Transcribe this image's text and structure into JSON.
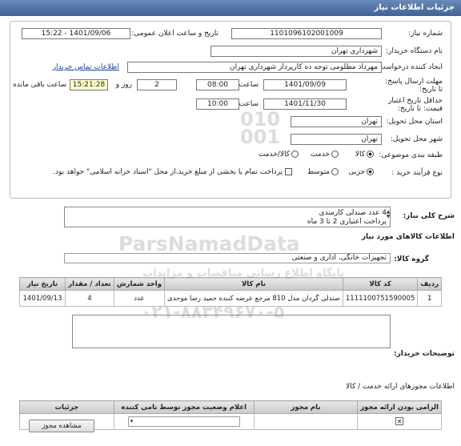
{
  "header": {
    "title": "جزئیات اطلاعات نیاز"
  },
  "fields": {
    "need_number_label": "شماره نیاز:",
    "need_number": "1101096102001009",
    "announce_label": "تاریخ و ساعت اعلان عمومی:",
    "announce_value": "1401/09/06 - 15:22",
    "buyer_label": "نام دستگاه خریدار:",
    "buyer_value": "شهرداری تهران",
    "creator_label": "ایجاد کننده درخواست:",
    "creator_value": "مهرداد مظلومی توجه ده کارپرداز شهرداری تهران",
    "contact_link": "اطلاعات تماس خریدار",
    "deadline_label": "مهلت ارسال پاسخ: تا تاریخ:",
    "deadline_date": "1401/09/09",
    "time_label": "ساعت",
    "deadline_time": "08:00",
    "days_value": "2",
    "days_label": "روز و",
    "remaining_time": "15:21:28",
    "remaining_label": "ساعت باقی مانده",
    "validity_label": "حداقل تاریخ اعتبار قیمت: تا تاریخ:",
    "validity_date": "1401/11/30",
    "validity_time_label": "ساعت",
    "validity_time": "10:00",
    "province_label": "استان محل تحویل:",
    "province_value": "تهران",
    "city_label": "شهر محل تحویل:",
    "city_value": "تهران",
    "category_label": "طبقه بندی موضوعی:",
    "category_options": [
      "کالا",
      "خدمت",
      "کالا/خدمت"
    ],
    "purchase_label": "نوع فرآیند خرید :",
    "purchase_options": [
      "جزیی",
      "متوسط"
    ],
    "payment_note": "پرداخت تمام یا بخشی از مبلغ خرید،از محل \"اسناد خزانه اسلامی\" خواهد بود."
  },
  "description": {
    "label": "شرح کلی نیاز:",
    "lines": [
      "4 عدد صندلی کارمندی",
      "پرداخت اعتباری 2 تا 3 ماه"
    ]
  },
  "goods": {
    "title": "اطلاعات کالاهای مورد نیاز",
    "group_label": "گروه کالا:",
    "group_value": "تجهیزات خانگی، اداری و صنعتی",
    "columns": [
      "ردیف",
      "کد کالا",
      "نام کالا",
      "واحد شمارش",
      "تعداد / مقدار",
      "تاریخ نیاز"
    ],
    "rows": [
      [
        "1",
        "1111100751590005",
        "صندلی گردان مدل 810 مرجع عرضه کننده حمید رضا موحدی",
        "عدد",
        "4",
        "1401/09/13"
      ]
    ]
  },
  "buyer_notes": {
    "label": "توضیحات خریدار:"
  },
  "permits": {
    "title": "اطلاعات مجوزهای ارائه خدمت / کالا",
    "columns": [
      "الزامی بودن ارائه مجوز",
      "نام مجوز",
      "اعلام وضعیت مجوز توسط نامی کننده",
      "جزئیات"
    ],
    "view_button": "مشاهده مجوز"
  },
  "watermarks": {
    "brand": "ParsNamadData",
    "persian": "پایگاه اطلاع رسانی مناقصات و مزایدات",
    "phone": "۰۲۱-۸۸۳۴۹۶۷۰-۵",
    "digits": "010\n001"
  }
}
